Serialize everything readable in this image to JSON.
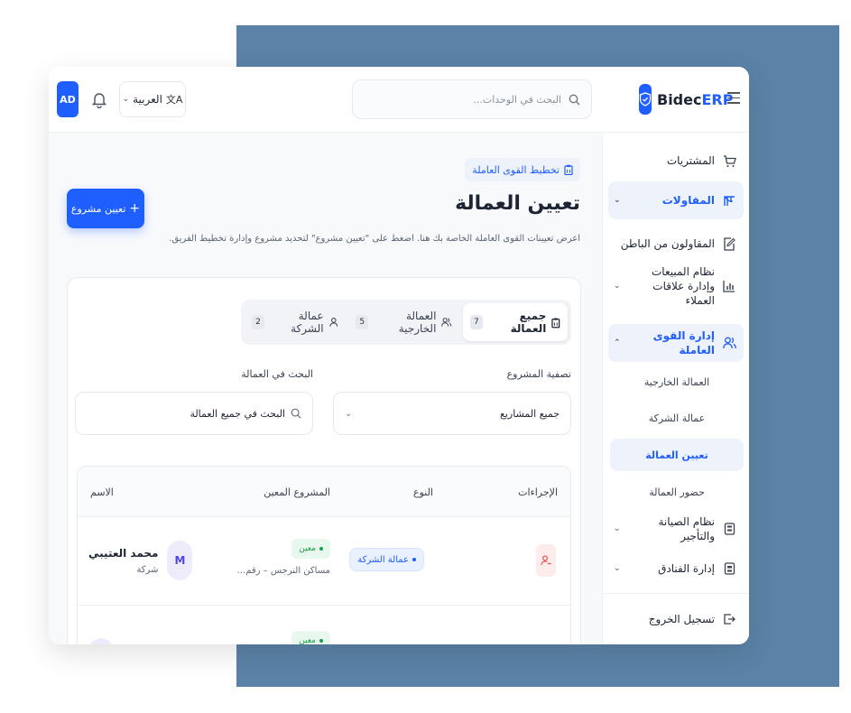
{
  "app": {
    "brand_prefix": "Bidec",
    "brand_suffix": "ERP",
    "user_initials": "AD"
  },
  "header": {
    "language": "العربية",
    "search_placeholder": "البحث في الوحدات..."
  },
  "sidebar": {
    "items": [
      {
        "label": "المشتريات",
        "icon": "cart-icon"
      },
      {
        "label": "المقاولات",
        "icon": "crane-icon"
      },
      {
        "label": "المقاولون من الباطن",
        "icon": "edit-doc-icon"
      },
      {
        "label": "نظام المبيعات وإدارة علاقات العملاء",
        "icon": "chart-icon"
      },
      {
        "label": "إدارة القوى العاملة",
        "icon": "users-icon"
      },
      {
        "label": "نظام الصيانة والتأجير",
        "icon": "building-icon"
      },
      {
        "label": "إدارة الفنادق",
        "icon": "hotel-icon"
      }
    ],
    "sub_items": [
      "العمالة الخارجية",
      "عمالة الشركة",
      "تعيين العمالة",
      "حضور العمالة"
    ],
    "logout": "تسجيل الخروج"
  },
  "main": {
    "breadcrumb": "تخطيط القوى العاملة",
    "title": "تعيين العمالة",
    "description": "اعرض تعيينات القوى العاملة الخاصة بك هنا. اضغط على \"تعيين مشروع\" لتحديد مشروع وإدارة تخطيط الفريق.",
    "assign_button": "تعيين مشروع",
    "tabs": [
      {
        "label": "جميع العمالة",
        "count": "7"
      },
      {
        "label": "العمالة الخارجية",
        "count": "5"
      },
      {
        "label": "عمالة الشركة",
        "count": "2"
      }
    ],
    "filters": {
      "project_label": "تصفية المشروع",
      "project_value": "جميع المشاريع",
      "search_label": "البحث في العمالة",
      "search_placeholder": "البحث في جميع العمالة"
    },
    "table": {
      "columns": [
        "الإجراءات",
        "النوع",
        "المشروع المعين",
        "الاسم"
      ],
      "rows": [
        {
          "name": "محمد العتيبي",
          "subtitle": "شركة",
          "initial": "M",
          "status": "معين",
          "project": "مساكن النرجس – رقم...",
          "type": "عمالة الشركة"
        },
        {
          "status": "معين"
        }
      ]
    }
  },
  "colors": {
    "accent": "#1f5eff",
    "backdrop": "#5b83a7"
  }
}
